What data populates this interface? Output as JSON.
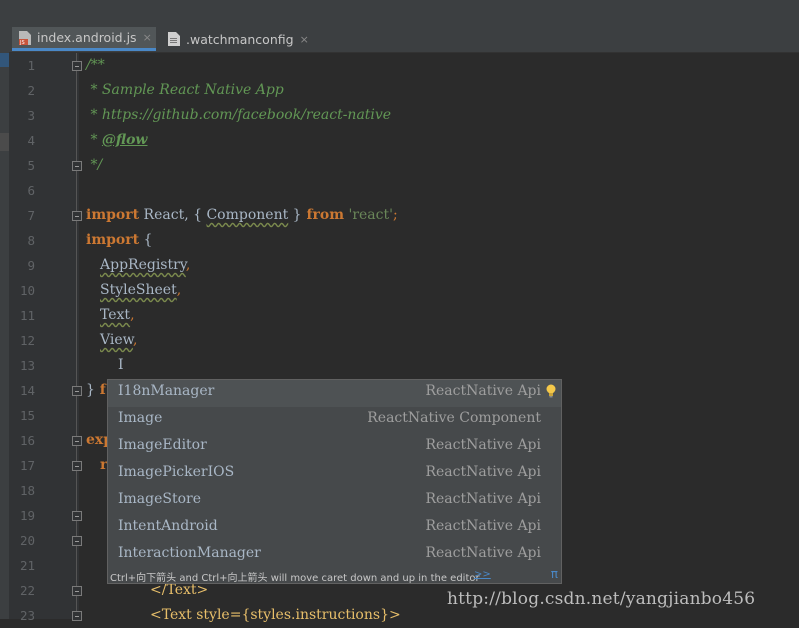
{
  "tabs": [
    {
      "label": "index.android.js",
      "icon": "js-file-icon",
      "active": true
    },
    {
      "label": ".watchmanconfig",
      "icon": "text-file-icon",
      "active": false
    }
  ],
  "close_glyph": "×",
  "line_numbers": [
    "1",
    "2",
    "3",
    "4",
    "5",
    "6",
    "7",
    "8",
    "9",
    "10",
    "11",
    "12",
    "13",
    "14",
    "15",
    "16",
    "17",
    "18",
    "19",
    "20",
    "21",
    "22",
    "23"
  ],
  "code": {
    "l1": {
      "text": "/**"
    },
    "l2": {
      "text": " * Sample React Native App"
    },
    "l3": {
      "text": " * https://github.com/facebook/react-native"
    },
    "l4": {
      "star": " * ",
      "tag": "@flow"
    },
    "l5": {
      "text": " */"
    },
    "l7": {
      "kw1": "import",
      "mid": " React, ",
      "brace1": "{ ",
      "comp": "Component",
      "brace2": " }",
      "kw2": " from",
      "str": " 'react'",
      "semi": ";"
    },
    "l8": {
      "kw": "import",
      "rest": " {"
    },
    "l9": {
      "name": "AppRegistry",
      "comma": ","
    },
    "l10": {
      "name": "StyleSheet",
      "comma": ","
    },
    "l11": {
      "name": "Text",
      "comma": ","
    },
    "l12": {
      "name": "View",
      "comma": ","
    },
    "l13": {
      "text": "I"
    },
    "l14": {
      "brace": "}",
      "kw": " f"
    },
    "l16": {
      "kw": "exp"
    },
    "l17": {
      "kw": "r"
    },
    "l22": {
      "text": "</Text>"
    },
    "l23": {
      "text": "<Text style={styles.instructions}>"
    }
  },
  "autocomplete": {
    "items": [
      {
        "name": "I18nManager",
        "type": "ReactNative Api",
        "selected": true
      },
      {
        "name": "Image",
        "type": "ReactNative Component",
        "selected": false
      },
      {
        "name": "ImageEditor",
        "type": "ReactNative Api",
        "selected": false
      },
      {
        "name": "ImagePickerIOS",
        "type": "ReactNative Api",
        "selected": false
      },
      {
        "name": "ImageStore",
        "type": "ReactNative Api",
        "selected": false
      },
      {
        "name": "IntentAndroid",
        "type": "ReactNative Api",
        "selected": false
      },
      {
        "name": "InteractionManager",
        "type": "ReactNative Api",
        "selected": false
      }
    ],
    "footer_hint": "Ctrl+向下箭头 and Ctrl+向上箭头 will move caret down and up in the editor",
    "footer_link": ">>",
    "footer_pi": "π"
  },
  "watermark": "http://blog.csdn.net/yangjianbo456",
  "colors": {
    "background": "#2b2b2b",
    "keyword": "#cc7832",
    "comment": "#629755",
    "string": "#6a8759",
    "identifier": "#a9b7c6"
  }
}
